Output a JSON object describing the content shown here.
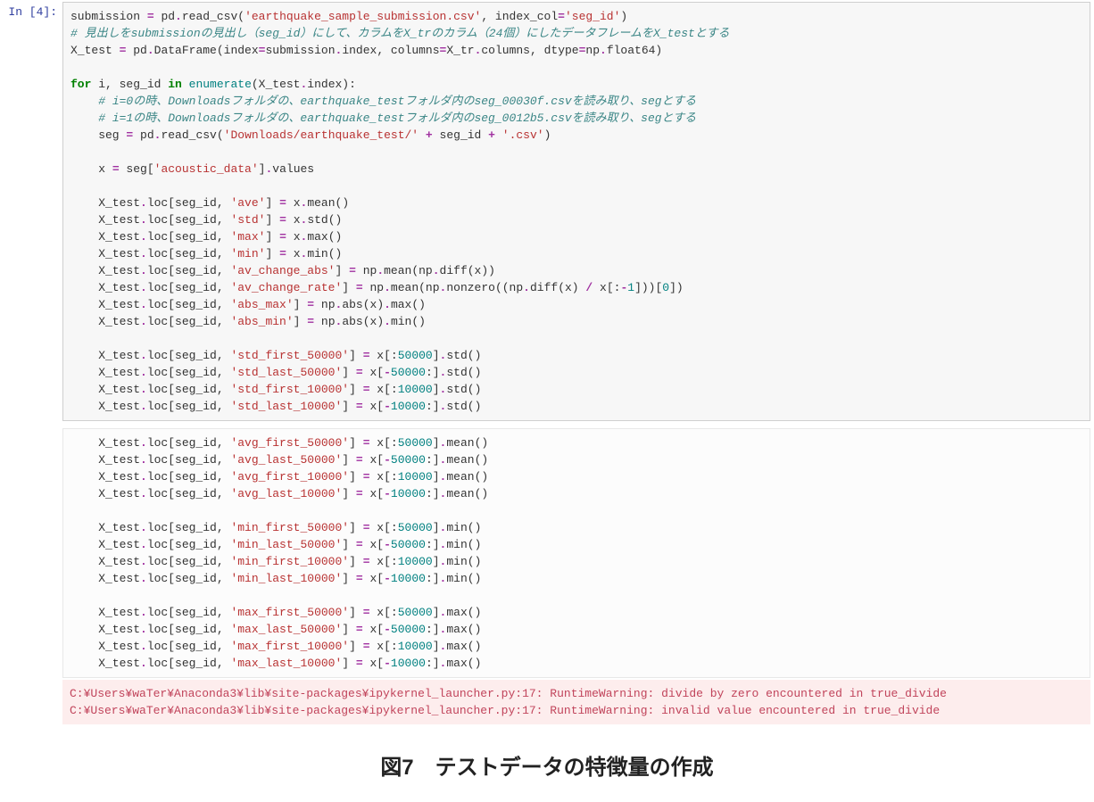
{
  "prompt_label": "In [4]:",
  "caption": "図7　テストデータの特徴量の作成",
  "code_block_1": [
    [
      [
        "t",
        "submission "
      ],
      [
        "op",
        "="
      ],
      [
        "t",
        " pd"
      ],
      [
        "op",
        "."
      ],
      [
        "t",
        "read_csv("
      ],
      [
        "s",
        "'earthquake_sample_submission.csv'"
      ],
      [
        "t",
        ", index_col"
      ],
      [
        "op",
        "="
      ],
      [
        "s",
        "'seg_id'"
      ],
      [
        "t",
        ")"
      ]
    ],
    [
      [
        "cm",
        "# 見出しをsubmissionの見出し（seg_id）にして、カラムをX_trのカラム（24個）にしたデータフレームをX_testとする"
      ]
    ],
    [
      [
        "t",
        "X_test "
      ],
      [
        "op",
        "="
      ],
      [
        "t",
        " pd"
      ],
      [
        "op",
        "."
      ],
      [
        "t",
        "DataFrame(index"
      ],
      [
        "op",
        "="
      ],
      [
        "t",
        "submission"
      ],
      [
        "op",
        "."
      ],
      [
        "t",
        "index, columns"
      ],
      [
        "op",
        "="
      ],
      [
        "t",
        "X_tr"
      ],
      [
        "op",
        "."
      ],
      [
        "t",
        "columns, dtype"
      ],
      [
        "op",
        "="
      ],
      [
        "t",
        "np"
      ],
      [
        "op",
        "."
      ],
      [
        "t",
        "float64)"
      ]
    ],
    [],
    [
      [
        "kw",
        "for"
      ],
      [
        "t",
        " i, seg_id "
      ],
      [
        "kw",
        "in"
      ],
      [
        "t",
        " "
      ],
      [
        "nb",
        "enumerate"
      ],
      [
        "t",
        "(X_test"
      ],
      [
        "op",
        "."
      ],
      [
        "t",
        "index):"
      ]
    ],
    [
      [
        "t",
        "    "
      ],
      [
        "cm",
        "# i=0の時、Downloadsフォルダの、earthquake_testフォルダ内のseg_00030f.csvを読み取り、segとする"
      ]
    ],
    [
      [
        "t",
        "    "
      ],
      [
        "cm",
        "# i=1の時、Downloadsフォルダの、earthquake_testフォルダ内のseg_0012b5.csvを読み取り、segとする"
      ]
    ],
    [
      [
        "t",
        "    seg "
      ],
      [
        "op",
        "="
      ],
      [
        "t",
        " pd"
      ],
      [
        "op",
        "."
      ],
      [
        "t",
        "read_csv("
      ],
      [
        "s",
        "'Downloads/earthquake_test/'"
      ],
      [
        "t",
        " "
      ],
      [
        "op",
        "+"
      ],
      [
        "t",
        " seg_id "
      ],
      [
        "op",
        "+"
      ],
      [
        "t",
        " "
      ],
      [
        "s",
        "'.csv'"
      ],
      [
        "t",
        ")"
      ]
    ],
    [],
    [
      [
        "t",
        "    x "
      ],
      [
        "op",
        "="
      ],
      [
        "t",
        " seg["
      ],
      [
        "s",
        "'acoustic_data'"
      ],
      [
        "t",
        "]"
      ],
      [
        "op",
        "."
      ],
      [
        "t",
        "values"
      ]
    ],
    [],
    [
      [
        "t",
        "    X_test"
      ],
      [
        "op",
        "."
      ],
      [
        "t",
        "loc[seg_id, "
      ],
      [
        "s",
        "'ave'"
      ],
      [
        "t",
        "] "
      ],
      [
        "op",
        "="
      ],
      [
        "t",
        " x"
      ],
      [
        "op",
        "."
      ],
      [
        "t",
        "mean()"
      ]
    ],
    [
      [
        "t",
        "    X_test"
      ],
      [
        "op",
        "."
      ],
      [
        "t",
        "loc[seg_id, "
      ],
      [
        "s",
        "'std'"
      ],
      [
        "t",
        "] "
      ],
      [
        "op",
        "="
      ],
      [
        "t",
        " x"
      ],
      [
        "op",
        "."
      ],
      [
        "t",
        "std()"
      ]
    ],
    [
      [
        "t",
        "    X_test"
      ],
      [
        "op",
        "."
      ],
      [
        "t",
        "loc[seg_id, "
      ],
      [
        "s",
        "'max'"
      ],
      [
        "t",
        "] "
      ],
      [
        "op",
        "="
      ],
      [
        "t",
        " x"
      ],
      [
        "op",
        "."
      ],
      [
        "t",
        "max()"
      ]
    ],
    [
      [
        "t",
        "    X_test"
      ],
      [
        "op",
        "."
      ],
      [
        "t",
        "loc[seg_id, "
      ],
      [
        "s",
        "'min'"
      ],
      [
        "t",
        "] "
      ],
      [
        "op",
        "="
      ],
      [
        "t",
        " x"
      ],
      [
        "op",
        "."
      ],
      [
        "t",
        "min()"
      ]
    ],
    [
      [
        "t",
        "    X_test"
      ],
      [
        "op",
        "."
      ],
      [
        "t",
        "loc[seg_id, "
      ],
      [
        "s",
        "'av_change_abs'"
      ],
      [
        "t",
        "] "
      ],
      [
        "op",
        "="
      ],
      [
        "t",
        " np"
      ],
      [
        "op",
        "."
      ],
      [
        "t",
        "mean(np"
      ],
      [
        "op",
        "."
      ],
      [
        "t",
        "diff(x))"
      ]
    ],
    [
      [
        "t",
        "    X_test"
      ],
      [
        "op",
        "."
      ],
      [
        "t",
        "loc[seg_id, "
      ],
      [
        "s",
        "'av_change_rate'"
      ],
      [
        "t",
        "] "
      ],
      [
        "op",
        "="
      ],
      [
        "t",
        " np"
      ],
      [
        "op",
        "."
      ],
      [
        "t",
        "mean(np"
      ],
      [
        "op",
        "."
      ],
      [
        "t",
        "nonzero((np"
      ],
      [
        "op",
        "."
      ],
      [
        "t",
        "diff(x) "
      ],
      [
        "op",
        "/"
      ],
      [
        "t",
        " x[:"
      ],
      [
        "op",
        "-"
      ],
      [
        "num",
        "1"
      ],
      [
        "t",
        "]))["
      ],
      [
        "num",
        "0"
      ],
      [
        "t",
        "])"
      ]
    ],
    [
      [
        "t",
        "    X_test"
      ],
      [
        "op",
        "."
      ],
      [
        "t",
        "loc[seg_id, "
      ],
      [
        "s",
        "'abs_max'"
      ],
      [
        "t",
        "] "
      ],
      [
        "op",
        "="
      ],
      [
        "t",
        " np"
      ],
      [
        "op",
        "."
      ],
      [
        "t",
        "abs(x)"
      ],
      [
        "op",
        "."
      ],
      [
        "t",
        "max()"
      ]
    ],
    [
      [
        "t",
        "    X_test"
      ],
      [
        "op",
        "."
      ],
      [
        "t",
        "loc[seg_id, "
      ],
      [
        "s",
        "'abs_min'"
      ],
      [
        "t",
        "] "
      ],
      [
        "op",
        "="
      ],
      [
        "t",
        " np"
      ],
      [
        "op",
        "."
      ],
      [
        "t",
        "abs(x)"
      ],
      [
        "op",
        "."
      ],
      [
        "t",
        "min()"
      ]
    ],
    [],
    [
      [
        "t",
        "    X_test"
      ],
      [
        "op",
        "."
      ],
      [
        "t",
        "loc[seg_id, "
      ],
      [
        "s",
        "'std_first_50000'"
      ],
      [
        "t",
        "] "
      ],
      [
        "op",
        "="
      ],
      [
        "t",
        " x[:"
      ],
      [
        "num",
        "50000"
      ],
      [
        "t",
        "]"
      ],
      [
        "op",
        "."
      ],
      [
        "t",
        "std()"
      ]
    ],
    [
      [
        "t",
        "    X_test"
      ],
      [
        "op",
        "."
      ],
      [
        "t",
        "loc[seg_id, "
      ],
      [
        "s",
        "'std_last_50000'"
      ],
      [
        "t",
        "] "
      ],
      [
        "op",
        "="
      ],
      [
        "t",
        " x["
      ],
      [
        "op",
        "-"
      ],
      [
        "num",
        "50000"
      ],
      [
        "t",
        ":]"
      ],
      [
        "op",
        "."
      ],
      [
        "t",
        "std()"
      ]
    ],
    [
      [
        "t",
        "    X_test"
      ],
      [
        "op",
        "."
      ],
      [
        "t",
        "loc[seg_id, "
      ],
      [
        "s",
        "'std_first_10000'"
      ],
      [
        "t",
        "] "
      ],
      [
        "op",
        "="
      ],
      [
        "t",
        " x[:"
      ],
      [
        "num",
        "10000"
      ],
      [
        "t",
        "]"
      ],
      [
        "op",
        "."
      ],
      [
        "t",
        "std()"
      ]
    ],
    [
      [
        "t",
        "    X_test"
      ],
      [
        "op",
        "."
      ],
      [
        "t",
        "loc[seg_id, "
      ],
      [
        "s",
        "'std_last_10000'"
      ],
      [
        "t",
        "] "
      ],
      [
        "op",
        "="
      ],
      [
        "t",
        " x["
      ],
      [
        "op",
        "-"
      ],
      [
        "num",
        "10000"
      ],
      [
        "t",
        ":]"
      ],
      [
        "op",
        "."
      ],
      [
        "t",
        "std()"
      ]
    ]
  ],
  "code_block_2": [
    [
      [
        "t",
        "    X_test"
      ],
      [
        "op",
        "."
      ],
      [
        "t",
        "loc[seg_id, "
      ],
      [
        "s",
        "'avg_first_50000'"
      ],
      [
        "t",
        "] "
      ],
      [
        "op",
        "="
      ],
      [
        "t",
        " x[:"
      ],
      [
        "num",
        "50000"
      ],
      [
        "t",
        "]"
      ],
      [
        "op",
        "."
      ],
      [
        "t",
        "mean()"
      ]
    ],
    [
      [
        "t",
        "    X_test"
      ],
      [
        "op",
        "."
      ],
      [
        "t",
        "loc[seg_id, "
      ],
      [
        "s",
        "'avg_last_50000'"
      ],
      [
        "t",
        "] "
      ],
      [
        "op",
        "="
      ],
      [
        "t",
        " x["
      ],
      [
        "op",
        "-"
      ],
      [
        "num",
        "50000"
      ],
      [
        "t",
        ":]"
      ],
      [
        "op",
        "."
      ],
      [
        "t",
        "mean()"
      ]
    ],
    [
      [
        "t",
        "    X_test"
      ],
      [
        "op",
        "."
      ],
      [
        "t",
        "loc[seg_id, "
      ],
      [
        "s",
        "'avg_first_10000'"
      ],
      [
        "t",
        "] "
      ],
      [
        "op",
        "="
      ],
      [
        "t",
        " x[:"
      ],
      [
        "num",
        "10000"
      ],
      [
        "t",
        "]"
      ],
      [
        "op",
        "."
      ],
      [
        "t",
        "mean()"
      ]
    ],
    [
      [
        "t",
        "    X_test"
      ],
      [
        "op",
        "."
      ],
      [
        "t",
        "loc[seg_id, "
      ],
      [
        "s",
        "'avg_last_10000'"
      ],
      [
        "t",
        "] "
      ],
      [
        "op",
        "="
      ],
      [
        "t",
        " x["
      ],
      [
        "op",
        "-"
      ],
      [
        "num",
        "10000"
      ],
      [
        "t",
        ":]"
      ],
      [
        "op",
        "."
      ],
      [
        "t",
        "mean()"
      ]
    ],
    [],
    [
      [
        "t",
        "    X_test"
      ],
      [
        "op",
        "."
      ],
      [
        "t",
        "loc[seg_id, "
      ],
      [
        "s",
        "'min_first_50000'"
      ],
      [
        "t",
        "] "
      ],
      [
        "op",
        "="
      ],
      [
        "t",
        " x[:"
      ],
      [
        "num",
        "50000"
      ],
      [
        "t",
        "]"
      ],
      [
        "op",
        "."
      ],
      [
        "t",
        "min()"
      ]
    ],
    [
      [
        "t",
        "    X_test"
      ],
      [
        "op",
        "."
      ],
      [
        "t",
        "loc[seg_id, "
      ],
      [
        "s",
        "'min_last_50000'"
      ],
      [
        "t",
        "] "
      ],
      [
        "op",
        "="
      ],
      [
        "t",
        " x["
      ],
      [
        "op",
        "-"
      ],
      [
        "num",
        "50000"
      ],
      [
        "t",
        ":]"
      ],
      [
        "op",
        "."
      ],
      [
        "t",
        "min()"
      ]
    ],
    [
      [
        "t",
        "    X_test"
      ],
      [
        "op",
        "."
      ],
      [
        "t",
        "loc[seg_id, "
      ],
      [
        "s",
        "'min_first_10000'"
      ],
      [
        "t",
        "] "
      ],
      [
        "op",
        "="
      ],
      [
        "t",
        " x[:"
      ],
      [
        "num",
        "10000"
      ],
      [
        "t",
        "]"
      ],
      [
        "op",
        "."
      ],
      [
        "t",
        "min()"
      ]
    ],
    [
      [
        "t",
        "    X_test"
      ],
      [
        "op",
        "."
      ],
      [
        "t",
        "loc[seg_id, "
      ],
      [
        "s",
        "'min_last_10000'"
      ],
      [
        "t",
        "] "
      ],
      [
        "op",
        "="
      ],
      [
        "t",
        " x["
      ],
      [
        "op",
        "-"
      ],
      [
        "num",
        "10000"
      ],
      [
        "t",
        ":]"
      ],
      [
        "op",
        "."
      ],
      [
        "t",
        "min()"
      ]
    ],
    [],
    [
      [
        "t",
        "    X_test"
      ],
      [
        "op",
        "."
      ],
      [
        "t",
        "loc[seg_id, "
      ],
      [
        "s",
        "'max_first_50000'"
      ],
      [
        "t",
        "] "
      ],
      [
        "op",
        "="
      ],
      [
        "t",
        " x[:"
      ],
      [
        "num",
        "50000"
      ],
      [
        "t",
        "]"
      ],
      [
        "op",
        "."
      ],
      [
        "t",
        "max()"
      ]
    ],
    [
      [
        "t",
        "    X_test"
      ],
      [
        "op",
        "."
      ],
      [
        "t",
        "loc[seg_id, "
      ],
      [
        "s",
        "'max_last_50000'"
      ],
      [
        "t",
        "] "
      ],
      [
        "op",
        "="
      ],
      [
        "t",
        " x["
      ],
      [
        "op",
        "-"
      ],
      [
        "num",
        "50000"
      ],
      [
        "t",
        ":]"
      ],
      [
        "op",
        "."
      ],
      [
        "t",
        "max()"
      ]
    ],
    [
      [
        "t",
        "    X_test"
      ],
      [
        "op",
        "."
      ],
      [
        "t",
        "loc[seg_id, "
      ],
      [
        "s",
        "'max_first_10000'"
      ],
      [
        "t",
        "] "
      ],
      [
        "op",
        "="
      ],
      [
        "t",
        " x[:"
      ],
      [
        "num",
        "10000"
      ],
      [
        "t",
        "]"
      ],
      [
        "op",
        "."
      ],
      [
        "t",
        "max()"
      ]
    ],
    [
      [
        "t",
        "    X_test"
      ],
      [
        "op",
        "."
      ],
      [
        "t",
        "loc[seg_id, "
      ],
      [
        "s",
        "'max_last_10000'"
      ],
      [
        "t",
        "] "
      ],
      [
        "op",
        "="
      ],
      [
        "t",
        " x["
      ],
      [
        "op",
        "-"
      ],
      [
        "num",
        "10000"
      ],
      [
        "t",
        ":]"
      ],
      [
        "op",
        "."
      ],
      [
        "t",
        "max()"
      ]
    ]
  ],
  "stderr_lines": [
    "C:¥Users¥waTer¥Anaconda3¥lib¥site-packages¥ipykernel_launcher.py:17: RuntimeWarning: divide by zero encountered in true_divide",
    "C:¥Users¥waTer¥Anaconda3¥lib¥site-packages¥ipykernel_launcher.py:17: RuntimeWarning: invalid value encountered in true_divide"
  ]
}
